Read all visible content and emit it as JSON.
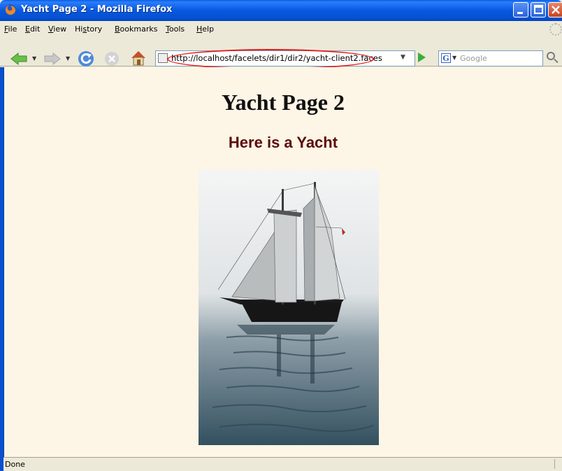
{
  "window": {
    "title": "Yacht Page 2 - Mozilla Firefox"
  },
  "menu": {
    "items": [
      {
        "label": "File",
        "u": "F",
        "rest": "ile"
      },
      {
        "label": "Edit",
        "u": "E",
        "rest": "dit"
      },
      {
        "label": "View",
        "u": "V",
        "rest": "iew"
      },
      {
        "label": "History",
        "pre": "Hi",
        "u": "s",
        "rest": "tory"
      },
      {
        "label": "Bookmarks",
        "u": "B",
        "rest": "ookmarks"
      },
      {
        "label": "Tools",
        "u": "T",
        "rest": "ools"
      },
      {
        "label": "Help",
        "u": "H",
        "rest": "elp"
      }
    ]
  },
  "navigation": {
    "url": "http://localhost/facelets/dir1/dir2/yacht-client2.faces",
    "search_placeholder": "Google"
  },
  "page": {
    "heading": "Yacht Page 2",
    "subheading": "Here is a Yacht",
    "image_alt": "Photo of a schooner under sail on calm water"
  },
  "status": {
    "text": "Done"
  },
  "colors": {
    "page_background": "#fdf5e6",
    "subheading": "#5a0c0c",
    "url_highlight": "#e31b1b"
  }
}
